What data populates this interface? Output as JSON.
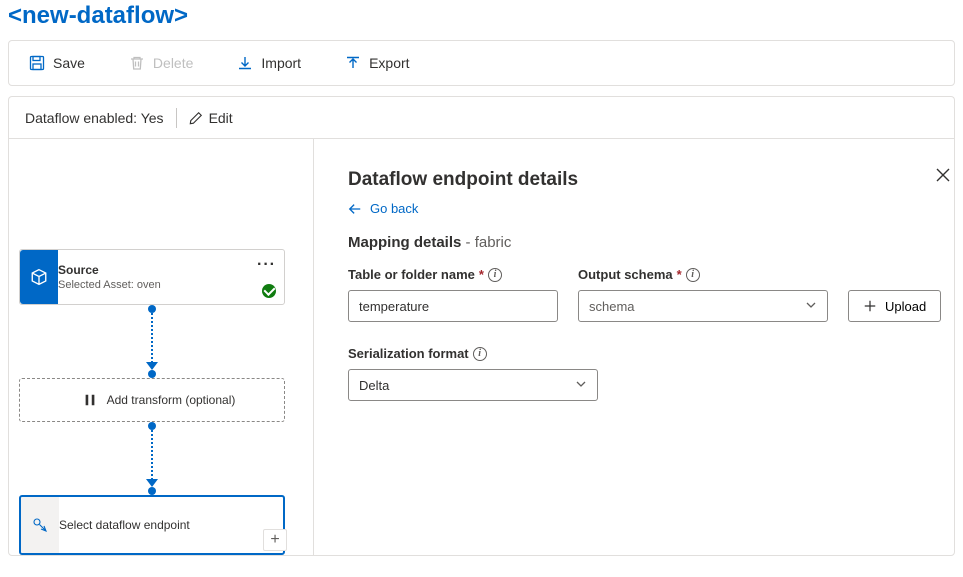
{
  "title": "<new-dataflow>",
  "toolbar": {
    "save": "Save",
    "delete": "Delete",
    "import": "Import",
    "export": "Export"
  },
  "status": {
    "enabled_label": "Dataflow enabled:",
    "enabled_value": "Yes",
    "edit": "Edit"
  },
  "canvas": {
    "source": {
      "label": "Source",
      "sub": "Selected Asset: oven"
    },
    "transform": {
      "label": "Add transform (optional)"
    },
    "endpoint": {
      "label": "Select dataflow endpoint"
    }
  },
  "details": {
    "heading": "Dataflow endpoint details",
    "go_back": "Go back",
    "section_title": "Mapping details",
    "section_sub": "fabric",
    "fields": {
      "table_label": "Table or folder name",
      "table_value": "temperature",
      "schema_label": "Output schema",
      "schema_placeholder": "schema",
      "upload": "Upload",
      "format_label": "Serialization format",
      "format_value": "Delta"
    }
  }
}
